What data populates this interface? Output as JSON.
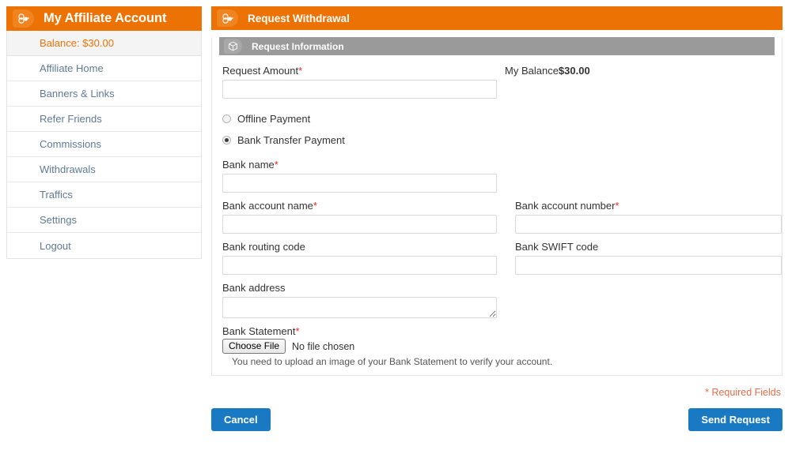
{
  "sidebar": {
    "icon": "affiliate-people-icon",
    "title": "My Affiliate Account",
    "balance_label": "Balance: $30.00",
    "items": [
      {
        "label": "Affiliate Home"
      },
      {
        "label": "Banners & Links"
      },
      {
        "label": "Refer Friends"
      },
      {
        "label": "Commissions"
      },
      {
        "label": "Withdrawals"
      },
      {
        "label": "Traffics"
      },
      {
        "label": "Settings"
      },
      {
        "label": "Logout"
      }
    ]
  },
  "main": {
    "header": {
      "icon": "affiliate-people-icon",
      "title": "Request Withdrawal"
    },
    "section": {
      "icon": "box-package-icon",
      "title": "Request Information"
    },
    "balance": {
      "label": "My Balance",
      "value": "$30.00"
    },
    "fields": {
      "request_amount": {
        "label": "Request Amount",
        "required": "*",
        "value": "",
        "placeholder": ""
      },
      "bank_name": {
        "label": "Bank name",
        "required": "*",
        "value": "",
        "placeholder": ""
      },
      "bank_account_name": {
        "label": "Bank account name",
        "required": "*",
        "value": "",
        "placeholder": ""
      },
      "bank_account_number": {
        "label": "Bank account number",
        "required": "*",
        "value": "",
        "placeholder": ""
      },
      "bank_routing_code": {
        "label": "Bank routing code",
        "required": "",
        "value": "",
        "placeholder": ""
      },
      "bank_swift_code": {
        "label": "Bank SWIFT code",
        "required": "",
        "value": "",
        "placeholder": ""
      },
      "bank_address": {
        "label": "Bank address",
        "required": "",
        "value": "",
        "placeholder": ""
      },
      "bank_statement": {
        "label": "Bank Statement",
        "required": "*",
        "button_label": "Choose File",
        "file_status": "No file chosen",
        "hint": "You need to upload an image of your Bank Statement to verify your account."
      }
    },
    "payment_methods": [
      {
        "label": "Offline Payment",
        "selected": false
      },
      {
        "label": "Bank Transfer Payment",
        "selected": true
      }
    ],
    "required_note": "* Required Fields",
    "buttons": {
      "cancel": "Cancel",
      "submit": "Send Request"
    }
  },
  "colors": {
    "orange": "#eb7203",
    "orange_light": "#f08421",
    "gray_bar": "#9a9a9a",
    "blue_button": "#1979c3",
    "link_blue": "#5e7a96",
    "required_red": "#e02b27",
    "required_note": "#e06e4a"
  }
}
